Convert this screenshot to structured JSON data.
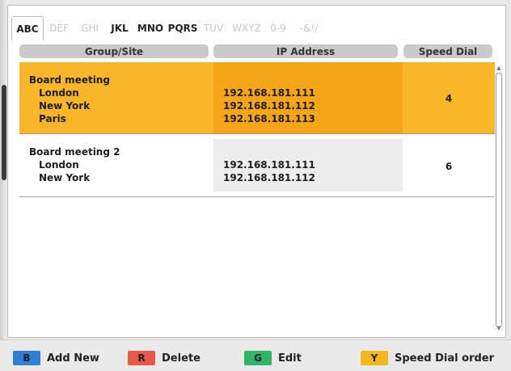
{
  "tabs": [
    "ABC",
    "DEF",
    "GHI",
    "JKL",
    "MNO",
    "PQRS",
    "TUV",
    "WXYZ",
    "0-9",
    "-&!/"
  ],
  "columns": {
    "group": "Group/Site",
    "ip": "IP Address",
    "speed": "Speed Dial"
  },
  "rows": [
    {
      "group": "Board meeting",
      "sites": [
        "London",
        "New York",
        "Paris"
      ],
      "ips": [
        "192.168.181.111",
        "192.168.181.112",
        "192.168.181.113"
      ],
      "speed": "4",
      "selected": true
    },
    {
      "group": "Board meeting 2",
      "sites": [
        "London",
        "New York"
      ],
      "ips": [
        "192.168.181.111",
        "192.168.181.112"
      ],
      "speed": "6",
      "selected": false
    }
  ],
  "footer": {
    "keys": [
      {
        "key": "B",
        "label": "Add New",
        "color": "#2f7fd6"
      },
      {
        "key": "R",
        "label": "Delete",
        "color": "#e8574a"
      },
      {
        "key": "G",
        "label": "Edit",
        "color": "#2fb46a"
      },
      {
        "key": "Y",
        "label": "Speed Dial order",
        "color": "#f3b81d"
      }
    ]
  },
  "colors": {
    "selected_row": "#f9b628",
    "selected_ip": "#f5a518",
    "header_bg": "#c9c9c9"
  }
}
